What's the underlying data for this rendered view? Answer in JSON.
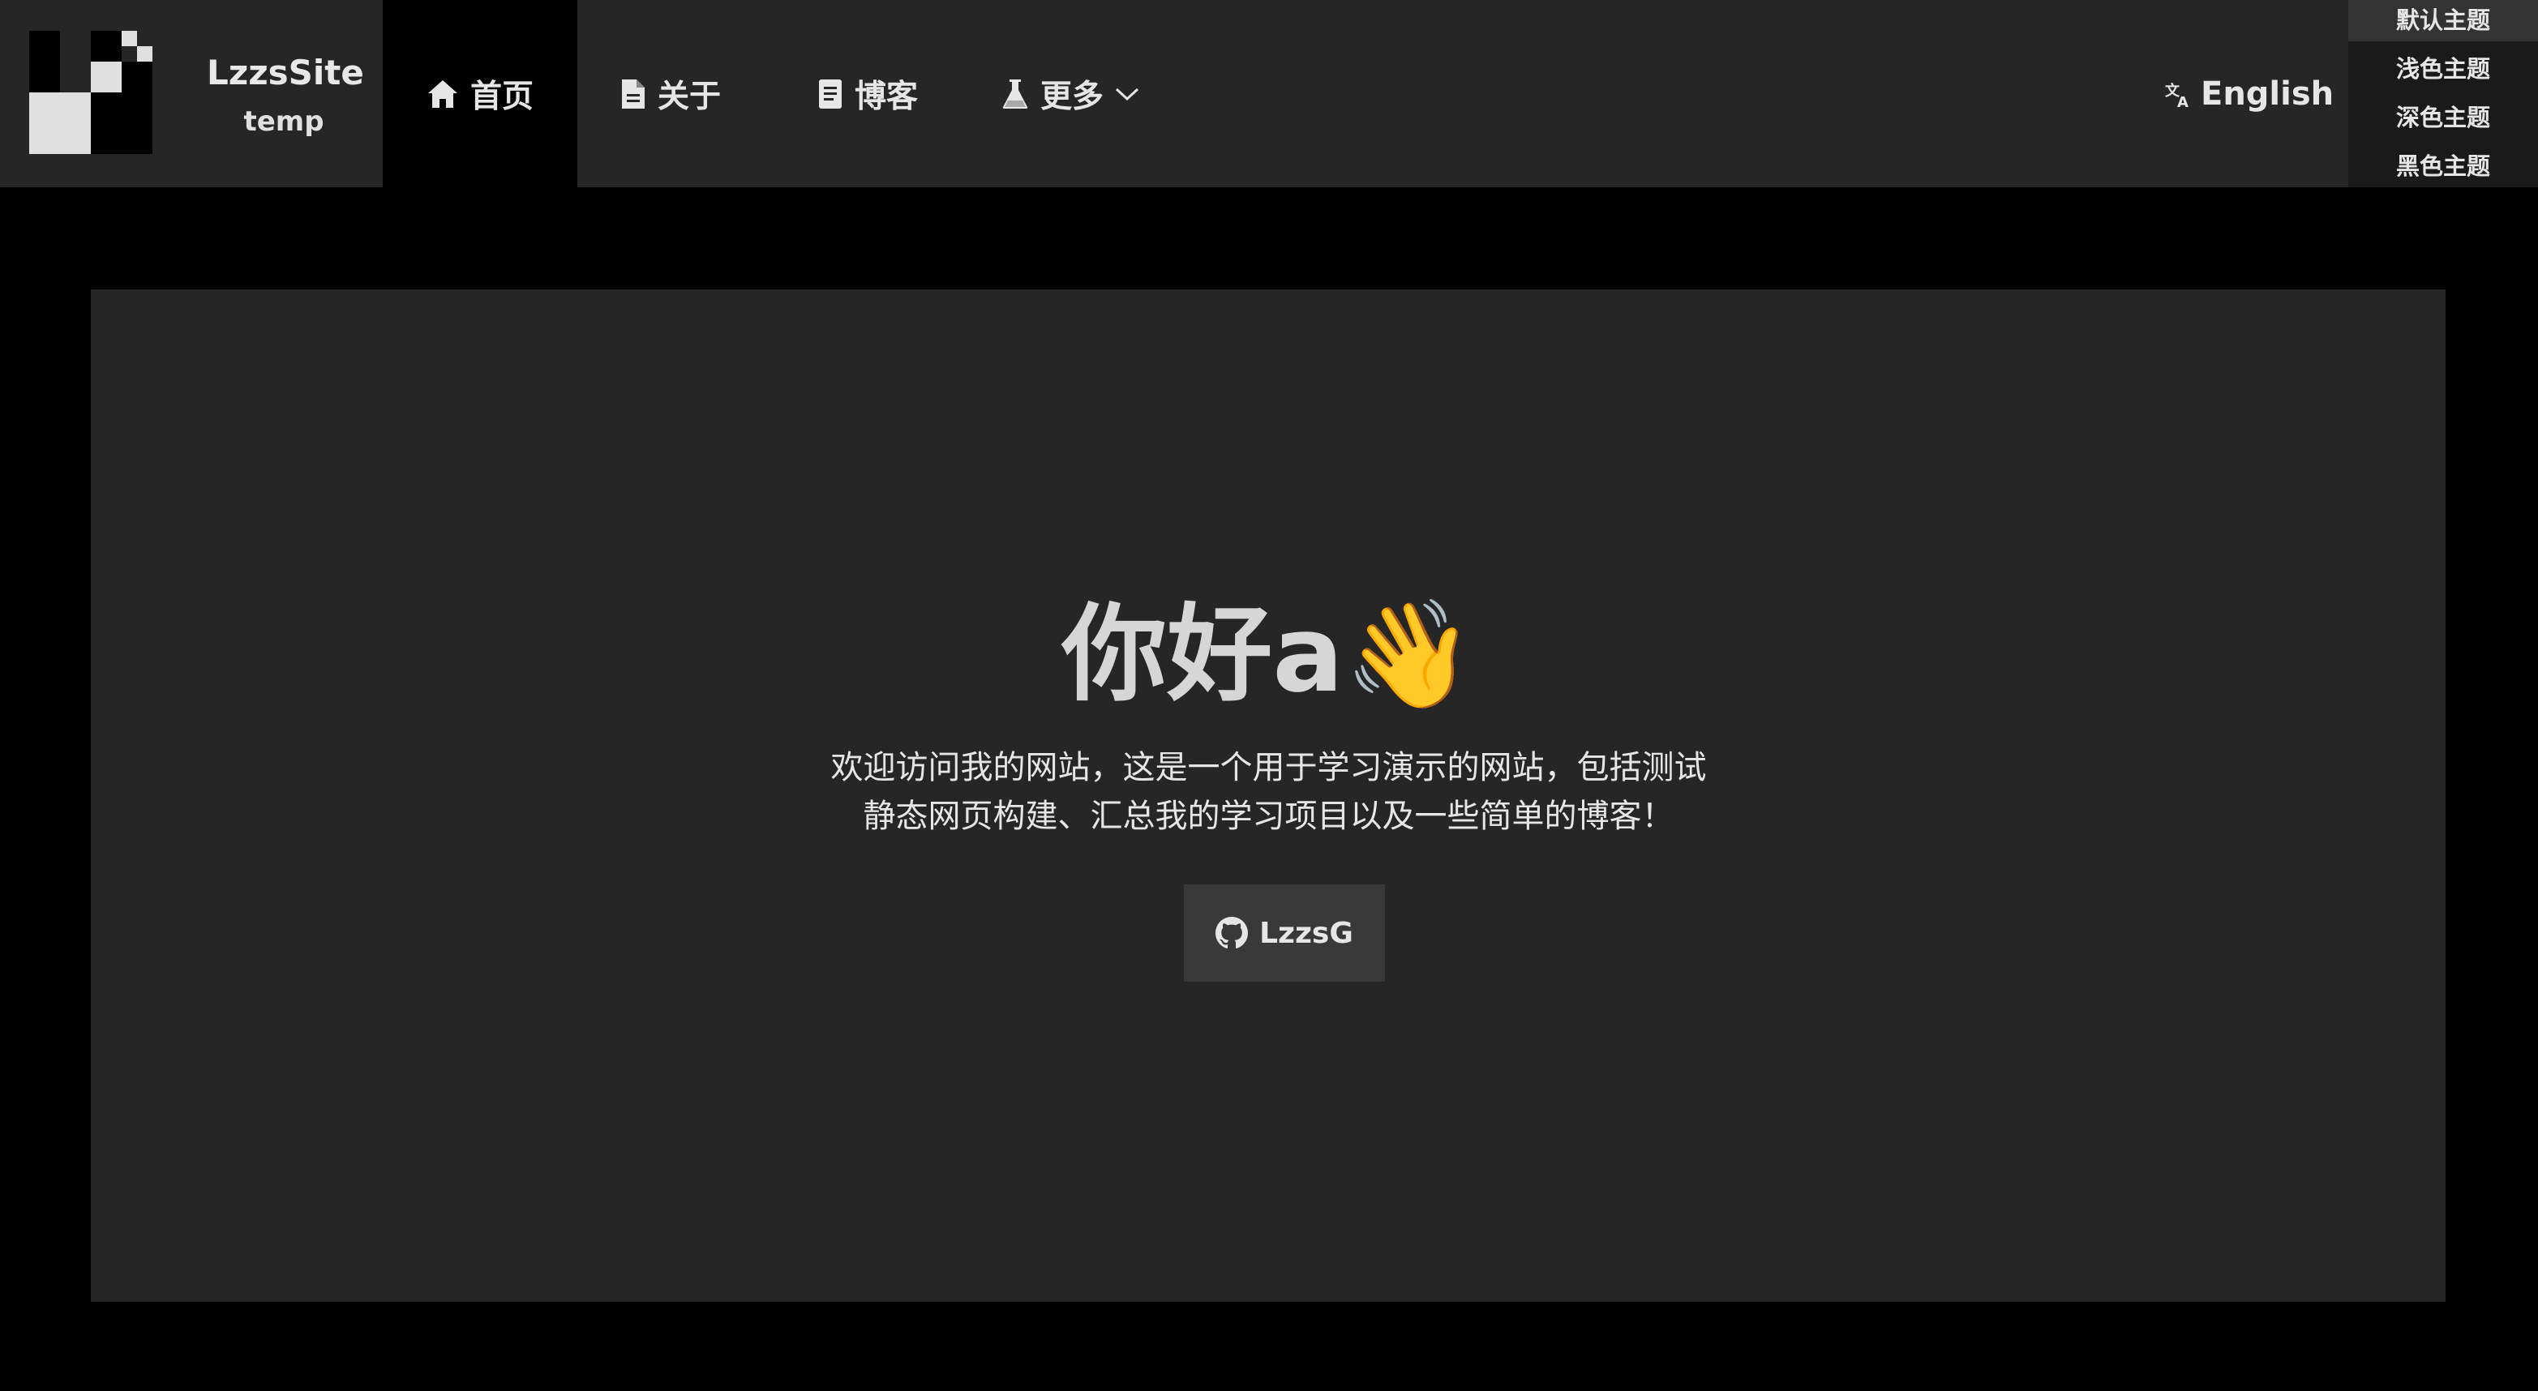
{
  "brand": {
    "name": "LzzsSite",
    "sub": "temp"
  },
  "nav": {
    "home": "首页",
    "about": "关于",
    "blog": "博客",
    "more": "更多"
  },
  "language": {
    "label": "English"
  },
  "theme_menu": {
    "items": [
      "默认主题",
      "浅色主题",
      "深色主题",
      "黑色主题"
    ],
    "selected": "默认主题"
  },
  "hero": {
    "title": "你好a👋",
    "description": "欢迎访问我的网站，这是一个用于学习演示的网站，包括测试静态网页构建、汇总我的学习项目以及一些简单的博客！",
    "button_label": "LzzsG"
  },
  "colors": {
    "navbar_bg": "#262626",
    "page_bg": "#000000",
    "hero_bg": "#262626",
    "button_bg": "#393939",
    "text": "#e6e6e6"
  },
  "icons": [
    "logo",
    "home-icon",
    "file-icon",
    "document-icon",
    "flask-icon",
    "chevron-down-icon",
    "translate-icon",
    "github-icon"
  ]
}
